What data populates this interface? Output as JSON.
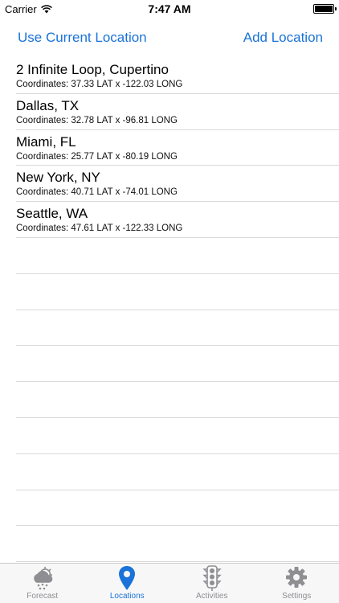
{
  "status": {
    "carrier": "Carrier",
    "time": "7:47 AM"
  },
  "nav": {
    "left_button": "Use Current Location",
    "right_button": "Add Location"
  },
  "locations": [
    {
      "name": "2 Infinite Loop, Cupertino",
      "coords": "Coordinates: 37.33 LAT x -122.03 LONG"
    },
    {
      "name": "Dallas, TX",
      "coords": "Coordinates: 32.78 LAT x -96.81 LONG"
    },
    {
      "name": "Miami, FL",
      "coords": "Coordinates: 25.77 LAT x -80.19 LONG"
    },
    {
      "name": "New York, NY",
      "coords": "Coordinates: 40.71 LAT x -74.01 LONG"
    },
    {
      "name": "Seattle, WA",
      "coords": "Coordinates: 47.61 LAT x -122.33 LONG"
    }
  ],
  "tabs": [
    {
      "label": "Forecast",
      "icon": "weather-icon",
      "active": false
    },
    {
      "label": "Locations",
      "icon": "location-pin-icon",
      "active": true
    },
    {
      "label": "Activities",
      "icon": "traffic-light-icon",
      "active": false
    },
    {
      "label": "Settings",
      "icon": "gear-icon",
      "active": false
    }
  ],
  "colors": {
    "accent": "#1a73d9",
    "inactive": "#8e8e93"
  }
}
